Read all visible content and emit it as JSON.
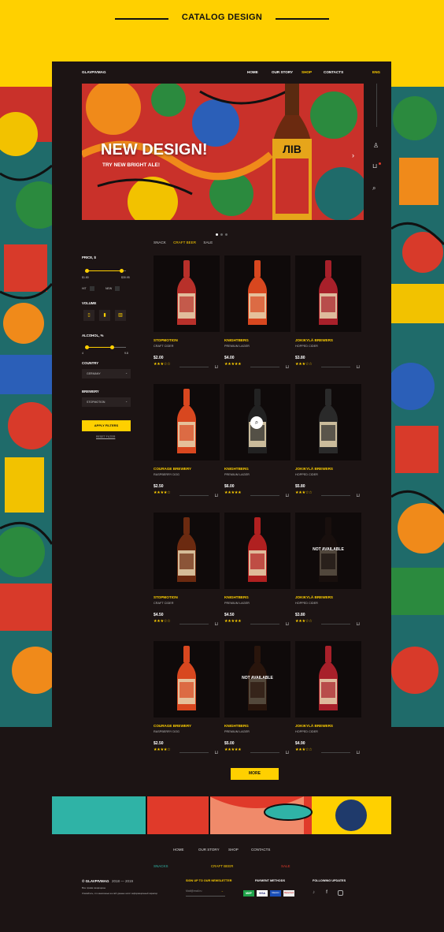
{
  "header": {
    "title": "CATALOG DESIGN"
  },
  "nav": {
    "logo": "GLAVPIVMAG",
    "links": [
      "HOME",
      "OUR STORY",
      "SHOP",
      "CONTACTS"
    ],
    "active": "SHOP",
    "lang": "ENG"
  },
  "banner": {
    "title": "NEW DESIGN!",
    "subtitle": "TRY NEW BRIGHT ALE!",
    "bottle_label": "ЛІВ",
    "slides": 3,
    "active_slide": 1
  },
  "filters": {
    "price_label": "PRICE, $",
    "price_min": "$1.80",
    "price_max": "$30.95",
    "hit": "HIT",
    "new": "NEW",
    "volume_label": "VOLUME",
    "alcohol_label": "ALCOHOL, %",
    "alc_min": "4",
    "alc_max": "9.8",
    "country_label": "COUNTRY",
    "country_value": "GERMANY",
    "brewery_label": "BREWERY",
    "brewery_value": "STOPMOTION",
    "apply": "APPLY FILTERS",
    "reset": "RESET FILTER"
  },
  "tabs": [
    "SNACK",
    "CRAFT BEER",
    "SALE"
  ],
  "active_tab": "CRAFT BEER",
  "products": [
    {
      "name": "STOPMOTION",
      "type": "CRAFT CIDER",
      "price": "$2.00",
      "rating": 3,
      "available": true,
      "color": "#b8302a"
    },
    {
      "name": "KNIGHTBERG",
      "type": "PREMIUM LAGER",
      "price": "$4.00",
      "rating": 5,
      "available": true,
      "color": "#d8471f"
    },
    {
      "name": "JOKIKYLÄ BREWERS",
      "type": "HOPPED CIDER",
      "price": "$3.80",
      "rating": 3,
      "available": true,
      "color": "#a8202a"
    },
    {
      "name": "COURAGE BREWERY",
      "type": "RASPBERRY DOG",
      "price": "$2.50",
      "rating": 4,
      "available": true,
      "color": "#d8471f"
    },
    {
      "name": "KNIGHTBERG",
      "type": "PREMIUM LAGER",
      "price": "$6.00",
      "rating": 5,
      "available": true,
      "color": "#222"
    },
    {
      "name": "JOKIKYLÄ BREWERS",
      "type": "HOPPED CIDER",
      "price": "$5.80",
      "rating": 3,
      "available": true,
      "color": "#2a2a2a"
    },
    {
      "name": "STOPMOTION",
      "type": "CRAFT CIDER",
      "price": "$4.50",
      "rating": 3,
      "available": true,
      "color": "#6b2a10"
    },
    {
      "name": "KNIGHTBERG",
      "type": "PREMIUM LAGER",
      "price": "$4.50",
      "rating": 5,
      "available": true,
      "color": "#b02020"
    },
    {
      "name": "JOKIKYLÄ BREWERS",
      "type": "HOPPED CIDER",
      "price": "$3.80",
      "rating": 3,
      "available": false,
      "color": "#2a1a14"
    },
    {
      "name": "COURAGE BREWERY",
      "type": "RASPBERRY DOG",
      "price": "$2.50",
      "rating": 4,
      "available": true,
      "color": "#d8471f"
    },
    {
      "name": "KNIGHTBERG",
      "type": "PREMIUM LAGER",
      "price": "$5.00",
      "rating": 5,
      "available": false,
      "color": "#5a2a10"
    },
    {
      "name": "JOKIKYLÄ BREWERS",
      "type": "HOPPED CIDER",
      "price": "$4.90",
      "rating": 3,
      "available": true,
      "color": "#a8202a"
    }
  ],
  "not_available": "NOT AVAILABLE",
  "more": "MORE",
  "footer": {
    "links": [
      "HOME",
      "OUR STORY",
      "SHOP",
      "CONTACTS"
    ],
    "categories": [
      "SNACKS",
      "CRAFT BEER",
      "SALE"
    ],
    "copyright": "© GLAVPIVMAG",
    "years": "2018 — 2019",
    "rights": "Все права защищены",
    "disclaimer": "Опасайтесь, что нанесенные на сайт данные носят информационный характер",
    "newsletter_label": "SIGN UP TO OUR NEWSLETTER",
    "newsletter_placeholder": "Mail@mail.ru",
    "payment_label": "PAYMENT METHODS",
    "payments": [
      "МИР",
      "VISA",
      "Maestro",
      "MasterCard"
    ],
    "follow_label": "FOLLOWING UPDATES"
  }
}
